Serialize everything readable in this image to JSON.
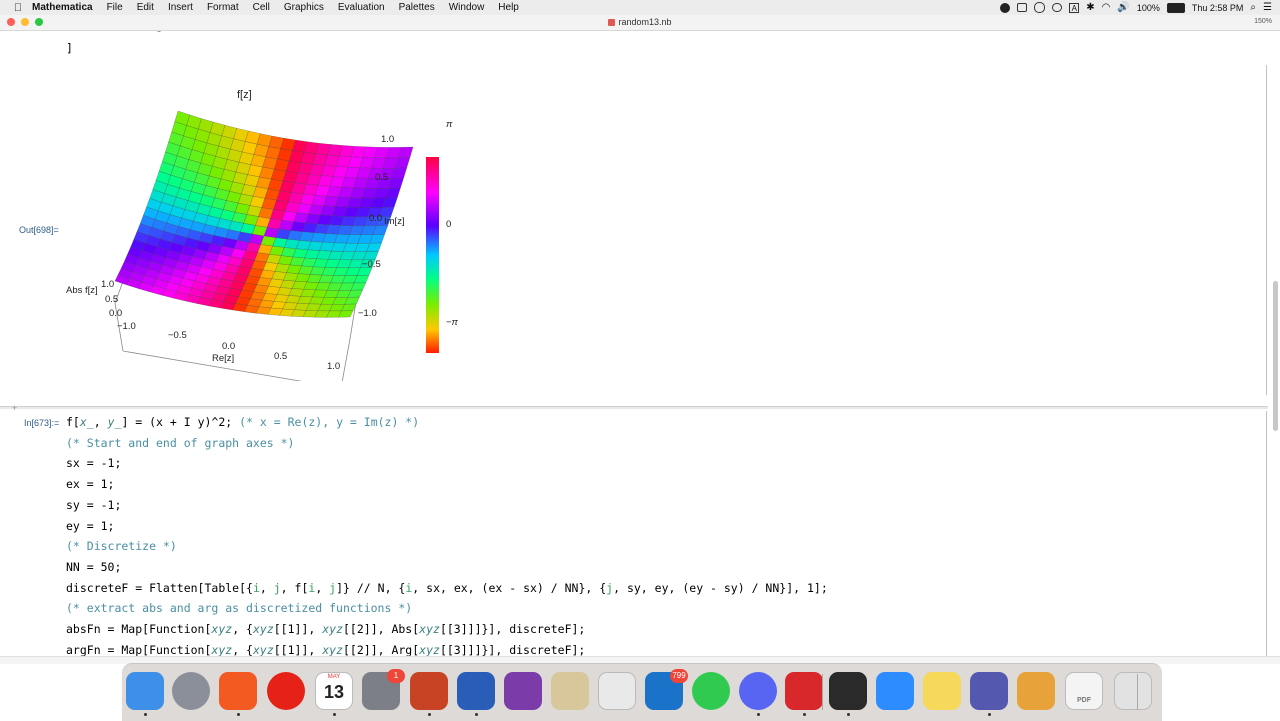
{
  "menubar": {
    "apple_icon": "apple-icon",
    "app_name": "Mathematica",
    "menus": [
      "File",
      "Edit",
      "Insert",
      "Format",
      "Cell",
      "Graphics",
      "Evaluation",
      "Palettes",
      "Window",
      "Help"
    ],
    "status": {
      "battery": "100%",
      "clock": "Thu 2:58 PM",
      "input_source": "A"
    }
  },
  "window": {
    "title": "random13.nb",
    "zoom": "150%"
  },
  "notebook": {
    "prev_bracket": "]",
    "output_label": "Out[698]=",
    "input_label": "In[673]:=",
    "plot": {
      "title": "f[z]",
      "x_label": "Re[z]",
      "y_label": "Im[z]",
      "z_label": "Abs f[z]",
      "x_ticks": [
        "−1.0",
        "−0.5",
        "0.0",
        "0.5",
        "1.0"
      ],
      "y_ticks": [
        "1.0",
        "0.5",
        "0.0",
        "−0.5",
        "−1.0"
      ],
      "z_ticks": [
        "1.0",
        "0.5",
        "0.0"
      ],
      "legend_top": "π",
      "legend_mid": "0",
      "legend_bottom": "−π"
    },
    "code": [
      {
        "parts": [
          [
            "f[",
            ""
          ],
          [
            "x_",
            "it"
          ],
          [
            ", ",
            ""
          ],
          [
            "y_",
            "it"
          ],
          [
            "] = (x + I y)^2; ",
            ""
          ],
          [
            "(* x = Re(z), y = Im(z) *)",
            "c"
          ]
        ]
      },
      {
        "parts": [
          [
            "(* Start and end of graph axes *)",
            "c"
          ]
        ]
      },
      {
        "parts": [
          [
            "sx = -1;",
            ""
          ]
        ]
      },
      {
        "parts": [
          [
            "ex = 1;",
            ""
          ]
        ]
      },
      {
        "parts": [
          [
            "sy = -1;",
            ""
          ]
        ]
      },
      {
        "parts": [
          [
            "ey = 1;",
            ""
          ]
        ]
      },
      {
        "parts": [
          [
            "(* Discretize *)",
            "c"
          ]
        ]
      },
      {
        "parts": [
          [
            "NN = 50;",
            ""
          ]
        ]
      },
      {
        "parts": [
          [
            "discreteF = Flatten[Table[{",
            ""
          ],
          [
            "i",
            "g"
          ],
          [
            ", ",
            ""
          ],
          [
            "j",
            "g"
          ],
          [
            ", f[",
            ""
          ],
          [
            "i",
            "g"
          ],
          [
            ", ",
            ""
          ],
          [
            "j",
            "g"
          ],
          [
            "]} // N, {",
            ""
          ],
          [
            "i",
            "g"
          ],
          [
            ", sx, ex, (ex - sx) / NN}, {",
            ""
          ],
          [
            "j",
            "g"
          ],
          [
            ", sy, ey, (ey - sy) / NN}], 1];",
            ""
          ]
        ]
      },
      {
        "parts": [
          [
            "(* extract abs and arg as discretized functions *)",
            "c"
          ]
        ]
      },
      {
        "parts": [
          [
            "absFn = Map[Function[",
            ""
          ],
          [
            "xyz",
            "it"
          ],
          [
            ", {",
            ""
          ],
          [
            "xyz",
            "it"
          ],
          [
            "[[1]], ",
            ""
          ],
          [
            "xyz",
            "it"
          ],
          [
            "[[2]], Abs[",
            ""
          ],
          [
            "xyz",
            "it"
          ],
          [
            "[[3]]]}], discreteF];",
            ""
          ]
        ]
      },
      {
        "parts": [
          [
            "argFn = Map[Function[",
            ""
          ],
          [
            "xyz",
            "it"
          ],
          [
            ", {",
            ""
          ],
          [
            "xyz",
            "it"
          ],
          [
            "[[1]], ",
            ""
          ],
          [
            "xyz",
            "it"
          ],
          [
            "[[2]], Arg[",
            ""
          ],
          [
            "xyz",
            "it"
          ],
          [
            "[[3]]]}], discreteF];",
            ""
          ]
        ]
      }
    ]
  },
  "dock": {
    "items": [
      {
        "name": "finder-icon",
        "color": "#3d8fe8"
      },
      {
        "name": "launchpad-icon",
        "color": "#8a8f99"
      },
      {
        "name": "brave-icon",
        "color": "#f25a22"
      },
      {
        "name": "youtube-icon",
        "color": "#e62117"
      },
      {
        "name": "calendar-icon",
        "color": "#ffffff",
        "label": "13",
        "month": "MAY"
      },
      {
        "name": "system-preferences-icon",
        "color": "#7c7f86",
        "badge": "1"
      },
      {
        "name": "powerpoint-icon",
        "color": "#c84323"
      },
      {
        "name": "word-icon",
        "color": "#2a5db8"
      },
      {
        "name": "onenote-icon",
        "color": "#7b3ba8"
      },
      {
        "name": "preview-icon",
        "color": "#d7c79b"
      },
      {
        "name": "script-editor-icon",
        "color": "#e9e9e9"
      },
      {
        "name": "outlook-icon",
        "color": "#1b73c9",
        "badge": "799"
      },
      {
        "name": "whatsapp-icon",
        "color": "#2fca4f"
      },
      {
        "name": "discord-icon",
        "color": "#5865f2"
      },
      {
        "name": "mathematica-icon",
        "color": "#d8282b"
      },
      {
        "name": "terminal-icon",
        "color": "#2a2a2a"
      },
      {
        "name": "zoom-icon",
        "color": "#2d8cff"
      },
      {
        "name": "notes-icon",
        "color": "#f6d95a"
      },
      {
        "name": "teams-icon",
        "color": "#5558af"
      },
      {
        "name": "pencil-app-icon",
        "color": "#e8a23a"
      },
      {
        "name": "pdf-document-icon",
        "color": "#f4f4f4",
        "label": "PDF"
      },
      {
        "name": "trash-icon",
        "color": "#e2e2e2"
      }
    ]
  }
}
